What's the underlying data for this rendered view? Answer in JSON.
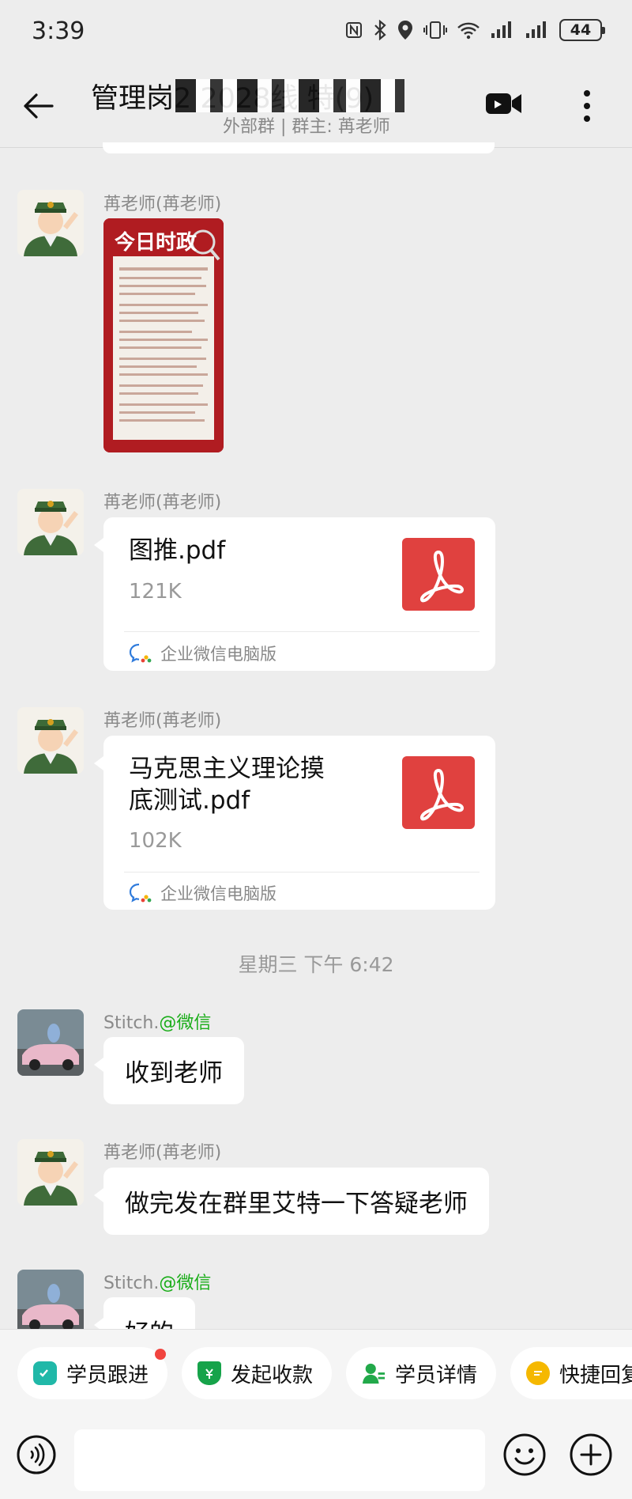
{
  "status_bar": {
    "time": "3:39",
    "battery": "44"
  },
  "header": {
    "title": "管理岗2 2028线 特(9)",
    "subtitle": "外部群 | 群主: 苒老师"
  },
  "messages": [
    {
      "sender": "苒老师(苒老师)",
      "type": "image",
      "image_text": "今日时政"
    },
    {
      "sender": "苒老师(苒老师)",
      "type": "file",
      "file_name": "图推.pdf",
      "file_size": "121K",
      "source": "企业微信电脑版"
    },
    {
      "sender": "苒老师(苒老师)",
      "type": "file",
      "file_name": "马克思主义理论摸底测试.pdf",
      "file_size": "102K",
      "source": "企业微信电脑版"
    },
    {
      "sender": "Stitch.",
      "sender_tag": "@微信",
      "type": "text",
      "text": "收到老师"
    },
    {
      "sender": "苒老师(苒老师)",
      "type": "text",
      "text": "做完发在群里艾特一下答疑老师"
    },
    {
      "sender": "Stitch.",
      "sender_tag": "@微信",
      "type": "text",
      "text": "好的"
    }
  ],
  "time_separator": "星期三 下午 6:42",
  "quick_actions": [
    {
      "label": "学员跟进",
      "icon": "follow-up-icon",
      "color": "#20b8a8",
      "badge": true
    },
    {
      "label": "发起收款",
      "icon": "payment-shield-icon",
      "color": "#16a34a",
      "badge": false
    },
    {
      "label": "学员详情",
      "icon": "student-detail-icon",
      "color": "#22a94a",
      "badge": false
    },
    {
      "label": "快捷回复",
      "icon": "quick-reply-icon",
      "color": "#f5b800",
      "badge": false
    }
  ],
  "colors": {
    "pdf": "#e0413f",
    "wechat_tag": "#1aad19",
    "background": "#ededed"
  }
}
